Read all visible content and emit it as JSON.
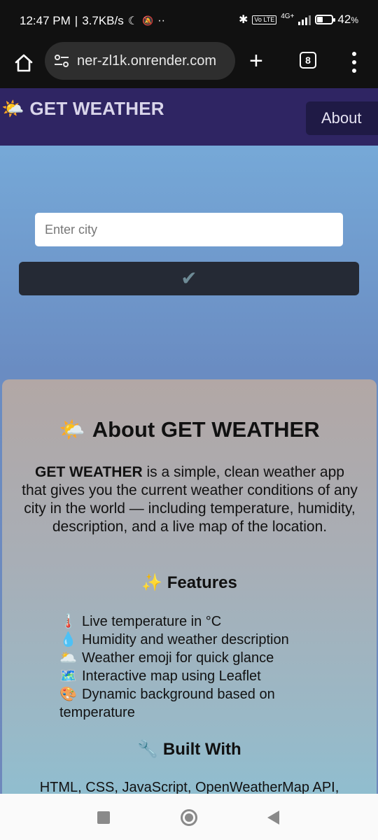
{
  "status_bar": {
    "time": "12:47 PM",
    "separator": "|",
    "speed": "3.7KB/s",
    "moon_icon": "☾",
    "muted_icon": "🔕",
    "dots": "··",
    "bluetooth_icon": "✱",
    "volte": "Vo LTE",
    "network": "4G+",
    "battery": "42",
    "battery_unit": "%",
    "battery_level": 0.42
  },
  "browser": {
    "url": "ner-zl1k.onrender.com",
    "new_tab_label": "+",
    "tab_count": "8"
  },
  "header": {
    "logo_emoji": "🌤️",
    "title": "GET WEATHER",
    "about_label": "About"
  },
  "search": {
    "placeholder": "Enter city",
    "submit_icon": "✔"
  },
  "about": {
    "heading_emoji": "🌤️",
    "heading": "About GET WEATHER",
    "desc_bold": "GET WEATHER",
    "desc_rest": " is a simple, clean weather app that gives you the current weather conditions of any city in the world — including temperature, humidity, description, and a live map of the location.",
    "features_emoji": "✨",
    "features_heading": "Features",
    "features": [
      {
        "icon": "🌡️",
        "text": "Live temperature in °C"
      },
      {
        "icon": "💧",
        "text": "Humidity and weather description"
      },
      {
        "icon": "🌥️",
        "text": "Weather emoji for quick glance"
      },
      {
        "icon": "🗺️",
        "text": "Interactive map using Leaflet"
      },
      {
        "icon": "🎨",
        "text": "Dynamic background based on temperature"
      }
    ],
    "built_emoji": "🔧",
    "built_heading": "Built With",
    "built_text": "HTML, CSS, JavaScript, OpenWeatherMap API,"
  }
}
